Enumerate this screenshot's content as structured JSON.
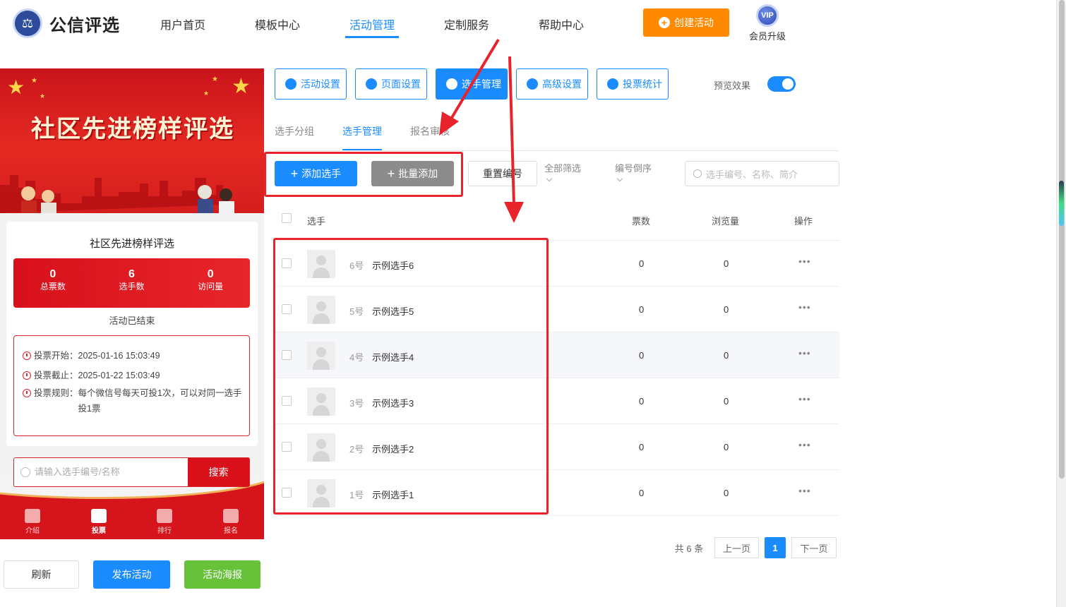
{
  "header": {
    "brand": "公信评选",
    "nav": [
      "用户首页",
      "模板中心",
      "活动管理",
      "定制服务",
      "帮助中心"
    ],
    "active_nav": "活动管理",
    "create_button": "创建活动",
    "vip_badge": "VIP",
    "vip_label": "会员升级"
  },
  "preview": {
    "banner_title": "社区先进榜样评选",
    "card_title": "社区先进榜样评选",
    "stats": [
      {
        "value": "0",
        "label": "总票数"
      },
      {
        "value": "6",
        "label": "选手数"
      },
      {
        "value": "0",
        "label": "访问量"
      }
    ],
    "status": "活动已结束",
    "rules": {
      "start_label": "投票开始：",
      "start_value": "2025-01-16 15:03:49",
      "end_label": "投票截止：",
      "end_value": "2025-01-22 15:03:49",
      "rule_label": "投票规则：",
      "rule_value": "每个微信号每天可投1次，可以对同一选手投1票"
    },
    "search_placeholder": "请输入选手编号/名称",
    "search_button": "搜索",
    "bottom_nav": [
      "介绍",
      "投票",
      "排行",
      "报名"
    ],
    "active_tab": "投票"
  },
  "actions": {
    "refresh": "刷新",
    "publish": "发布活动",
    "poster": "活动海报"
  },
  "toolbar": {
    "buttons": [
      "活动设置",
      "页面设置",
      "选手管理",
      "高级设置",
      "投票统计"
    ],
    "active": "选手管理",
    "preview_label": "预览效果",
    "preview_on": true
  },
  "subtabs": {
    "items": [
      "选手分组",
      "选手管理",
      "报名审核"
    ],
    "active": "选手管理"
  },
  "filters": {
    "add": "添加选手",
    "batch_add": "批量添加",
    "reset_numbers": "重置编号",
    "filter_all": "全部筛选",
    "sort": "编号倒序",
    "search_placeholder": "选手编号、名称、简介"
  },
  "table": {
    "headers": {
      "player": "选手",
      "votes": "票数",
      "views": "浏览量",
      "ops": "操作"
    },
    "rows": [
      {
        "num": "6号",
        "name": "示例选手6",
        "votes": "0",
        "views": "0",
        "more": "•••"
      },
      {
        "num": "5号",
        "name": "示例选手5",
        "votes": "0",
        "views": "0",
        "more": "•••"
      },
      {
        "num": "4号",
        "name": "示例选手4",
        "votes": "0",
        "views": "0",
        "more": "•••"
      },
      {
        "num": "3号",
        "name": "示例选手3",
        "votes": "0",
        "views": "0",
        "more": "•••"
      },
      {
        "num": "2号",
        "name": "示例选手2",
        "votes": "0",
        "views": "0",
        "more": "•••"
      },
      {
        "num": "1号",
        "name": "示例选手1",
        "votes": "0",
        "views": "0",
        "more": "•••"
      }
    ]
  },
  "pagination": {
    "total": "共 6 条",
    "prev": "上一页",
    "current": "1",
    "next": "下一页"
  },
  "colors": {
    "accent": "#1a8cff",
    "create": "#ff8a00",
    "annotation": "#e8232b",
    "poster": "#67c23a"
  }
}
